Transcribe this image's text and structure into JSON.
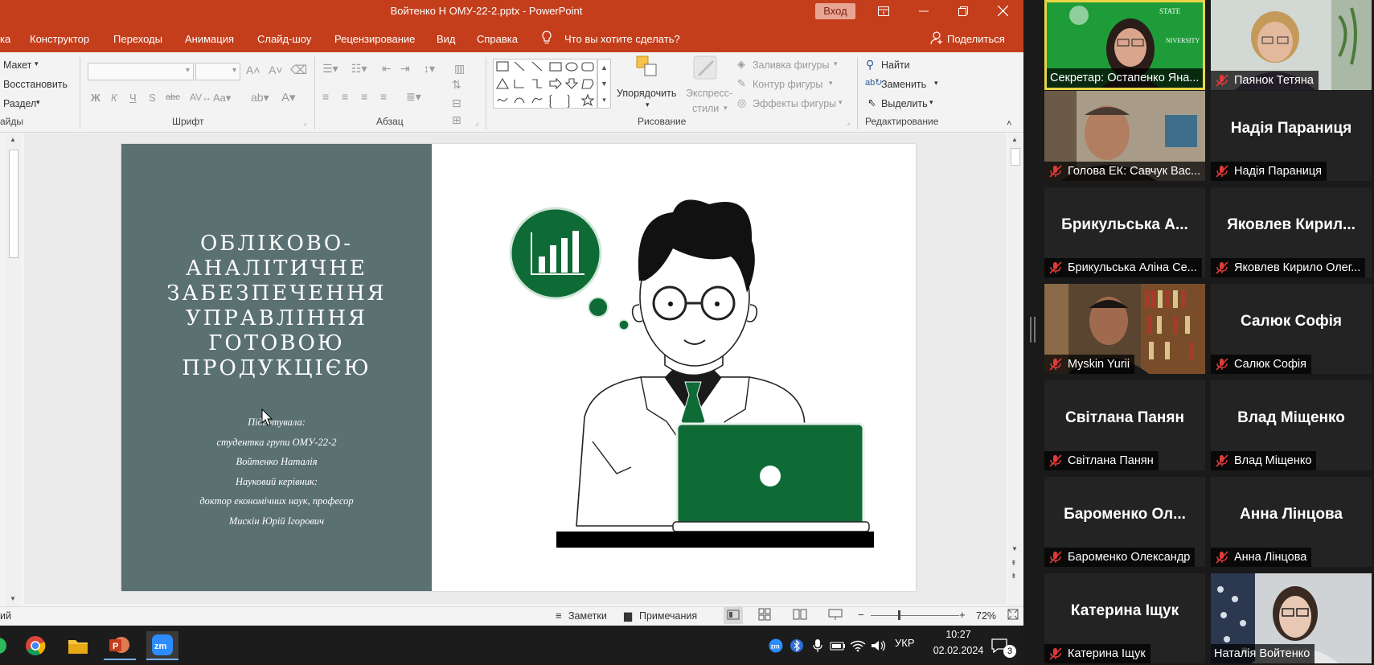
{
  "titlebar": {
    "title": "Войтенко Н ОМУ-22-2.pptx  -  PowerPoint",
    "login": "Вход"
  },
  "tabs": {
    "home_partial": "ка",
    "items": [
      "Конструктор",
      "Переходы",
      "Анимация",
      "Слайд-шоу",
      "Рецензирование",
      "Вид",
      "Справка"
    ],
    "tell_me": "Что вы хотите сделать?",
    "share": "Поделиться"
  },
  "ribbon": {
    "slides_group": {
      "layout": "Макет",
      "reset": "Восстановить",
      "section": "Раздел",
      "label": "айды"
    },
    "font_group": {
      "bold": "Ж",
      "italic": "К",
      "underline": "Ч",
      "strike": "S",
      "label": "Шрифт"
    },
    "paragraph_group": {
      "label": "Абзац"
    },
    "drawing_group": {
      "arrange": "Упорядочить",
      "quick_styles_1": "Экспресс-",
      "quick_styles_2": "стили",
      "fill": "Заливка фигуры",
      "outline": "Контур фигуры",
      "effects": "Эффекты фигуры",
      "label": "Рисование"
    },
    "editing_group": {
      "find": "Найти",
      "replace": "Заменить",
      "select": "Выделить",
      "label": "Редактирование"
    }
  },
  "slide": {
    "title_lines": [
      "ОБЛІКОВО-",
      "АНАЛІТИЧНЕ",
      "ЗАБЕЗПЕЧЕННЯ",
      "УПРАВЛІННЯ",
      "ГОТОВОЮ",
      "ПРОДУКЦІЄЮ"
    ],
    "info_lines": [
      "Підготувала:",
      "студентка групи ОМУ-22-2",
      "Войтенко Наталія",
      "Науковий керівник:",
      "доктор економічних наук, професор",
      "Мискін Юрій Ігорович"
    ]
  },
  "statusbar": {
    "left_partial": "ий",
    "notes": "Заметки",
    "comments": "Примечания",
    "zoom": "72%"
  },
  "taskbar": {
    "lang": "УКР",
    "time": "10:27",
    "date": "02.02.2024",
    "notifications": "3"
  },
  "zoom": {
    "tiles": [
      {
        "big": "",
        "label": "Секретар: Остапенко Яна..."
      },
      {
        "big": "",
        "label": "Паянок Тетяна"
      },
      {
        "big": "",
        "label": "Голова ЕК: Савчук Вас..."
      },
      {
        "big": "Надія Параниця",
        "label": "Надія Параниця"
      },
      {
        "big": "Брикульська А...",
        "label": "Брикульська Аліна Се..."
      },
      {
        "big": "Яковлев Кирил...",
        "label": "Яковлев Кирило Олег..."
      },
      {
        "big": "",
        "label": "Myskin Yurii"
      },
      {
        "big": "Салюк Софія",
        "label": "Салюк Софія"
      },
      {
        "big": "Світлана Панян",
        "label": "Світлана Панян"
      },
      {
        "big": "Влад Міщенко",
        "label": "Влад Міщенко"
      },
      {
        "big": "Бароменко Ол...",
        "label": "Бароменко Олександр"
      },
      {
        "big": "Анна Лінцова",
        "label": "Анна Лінцова"
      },
      {
        "big": "Катерина Іщук",
        "label": "Катерина Іщук"
      },
      {
        "big": "",
        "label": "Наталія Войтенко"
      }
    ]
  },
  "colors": {
    "ppt_accent": "#c43e1c",
    "slide_panel": "#5b7171",
    "slide_green": "#0f6b35",
    "active_speaker": "#e8d547",
    "muted": "#e03a3a"
  }
}
